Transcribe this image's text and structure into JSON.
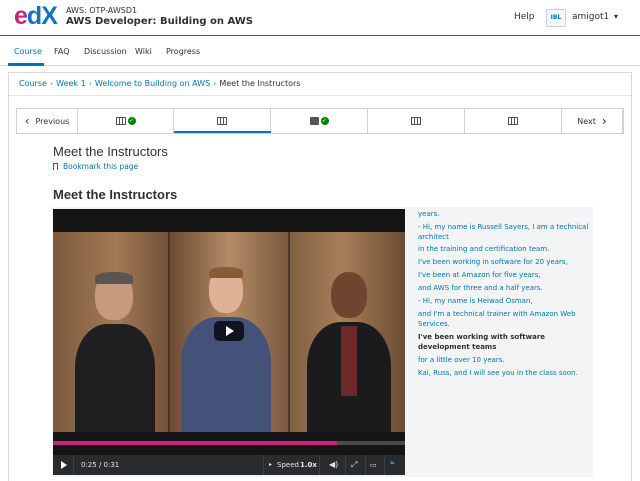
{
  "header": {
    "course_org": "AWS: OTP-AWSD1",
    "course_name": "AWS Developer: Building on AWS",
    "help": "Help",
    "avatar_text": "IBL",
    "username": "amigot1",
    "caret": "▾"
  },
  "tabs": [
    {
      "label": "Course",
      "active": true
    },
    {
      "label": "FAQ"
    },
    {
      "label": "Discussion"
    },
    {
      "label": "Wiki"
    },
    {
      "label": "Progress"
    }
  ],
  "breadcrumb": {
    "items": [
      "Course",
      "Week 1",
      "Welcome to Building on AWS"
    ],
    "current": "Meet the Instructors",
    "separator": "›"
  },
  "sequence": {
    "previous": "Previous",
    "next": "Next",
    "prev_chevron": "‹",
    "next_chevron": "›",
    "items": [
      {
        "icon": "video-icon",
        "completed": true
      },
      {
        "icon": "video-icon",
        "active": true
      },
      {
        "icon": "book-icon",
        "completed": true
      },
      {
        "icon": "video-icon"
      },
      {
        "icon": "video-icon"
      }
    ],
    "check_glyph": "✓"
  },
  "unit": {
    "title": "Meet the Instructors",
    "bookmark": "Bookmark this page",
    "component_title": "Meet the Instructors"
  },
  "video": {
    "time": "0:25 / 0:31",
    "speed_label": "Speed",
    "speed_value": "1.0x",
    "progress_fraction": 0.806,
    "accent_color": "#c5247a",
    "cc_label": "cc"
  },
  "transcript": [
    {
      "text": "years."
    },
    {
      "text": "- Hi, my name is Russell Sayers, I am a technical architect"
    },
    {
      "text": "in the training and certification team."
    },
    {
      "text": "I've been working in software for 20 years,"
    },
    {
      "text": "I've been at Amazon for five years,"
    },
    {
      "text": "and AWS for three and a half years."
    },
    {
      "text": "- Hi, my name is Heiwad Osman,"
    },
    {
      "text": "and I'm a technical trainer with Amazon Web Services."
    },
    {
      "text": "I've been working with software development teams",
      "current": true
    },
    {
      "text": "for a little over 10 years."
    },
    {
      "text": "Kai, Russ, and I will see you in the class soon."
    }
  ],
  "colors": {
    "link": "#0075b4",
    "brand_pink": "#c5247a",
    "check_green": "#008100"
  }
}
